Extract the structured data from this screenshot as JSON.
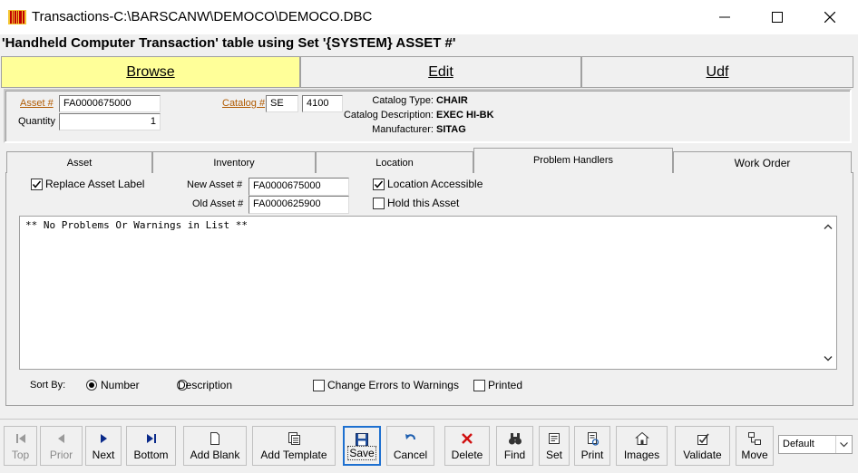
{
  "window": {
    "title": "Transactions-C:\\BARSCANW\\DEMOCO\\DEMOCO.DBC",
    "caption": "'Handheld Computer Transaction' table using Set '{SYSTEM} ASSET #'"
  },
  "main_tabs": [
    {
      "label": "Browse",
      "active_color": "#ffff99"
    },
    {
      "label": "Edit"
    },
    {
      "label": "Udf"
    }
  ],
  "header": {
    "asset_label": "Asset #",
    "asset_value": "FA0000675000",
    "quantity_label": "Quantity",
    "quantity_value": "1",
    "catalog_label": "Catalog #",
    "catalog_prefix": "SE",
    "catalog_number": "4100",
    "catalog_type_label": "Catalog Type:",
    "catalog_type_value": "CHAIR",
    "catalog_desc_label": "Catalog Description:",
    "catalog_desc_value": "EXEC HI-BK",
    "manufacturer_label": "Manufacturer:",
    "manufacturer_value": "SITAG"
  },
  "sub_tabs": [
    "Asset",
    "Inventory",
    "Location",
    "Problem Handlers",
    "Work Order"
  ],
  "problem_handlers": {
    "replace_asset_label": "Replace Asset Label",
    "replace_asset_checked": true,
    "new_asset_label": "New Asset #",
    "new_asset_value": "FA0000675000",
    "old_asset_label": "Old Asset #",
    "old_asset_value": "FA0000625900",
    "location_accessible_label": "Location Accessible",
    "location_accessible_checked": true,
    "hold_asset_label": "Hold this Asset",
    "hold_asset_checked": false,
    "list_text": "** No Problems Or Warnings in List **",
    "sort_by_label": "Sort By:",
    "sort_number_label": "Number",
    "sort_description_label": "Description",
    "sort_selected": "Number",
    "change_errors_label": "Change Errors to Warnings",
    "printed_label": "Printed"
  },
  "toolbar": {
    "buttons": [
      {
        "label": "Top",
        "icon": "first-icon",
        "enabled": false
      },
      {
        "label": "Prior",
        "icon": "prev-icon",
        "enabled": false
      },
      {
        "label": "Next",
        "icon": "next-icon",
        "enabled": true
      },
      {
        "label": "Bottom",
        "icon": "last-icon",
        "enabled": true
      },
      {
        "label": "Add Blank",
        "icon": "blank-page-icon",
        "enabled": true
      },
      {
        "label": "Add Template",
        "icon": "template-icon",
        "enabled": true
      },
      {
        "label": "Save",
        "icon": "floppy-icon",
        "enabled": true
      },
      {
        "label": "Cancel",
        "icon": "undo-icon",
        "enabled": true
      },
      {
        "label": "Delete",
        "icon": "delete-x-icon",
        "enabled": true
      },
      {
        "label": "Find",
        "icon": "binoculars-icon",
        "enabled": true
      },
      {
        "label": "Set",
        "icon": "set-icon",
        "enabled": true
      },
      {
        "label": "Print",
        "icon": "print-icon",
        "enabled": true
      },
      {
        "label": "Images",
        "icon": "images-icon",
        "enabled": true
      },
      {
        "label": "Validate",
        "icon": "validate-icon",
        "enabled": true
      },
      {
        "label": "Move",
        "icon": "move-icon",
        "enabled": true
      }
    ],
    "combo_value": "Default"
  }
}
